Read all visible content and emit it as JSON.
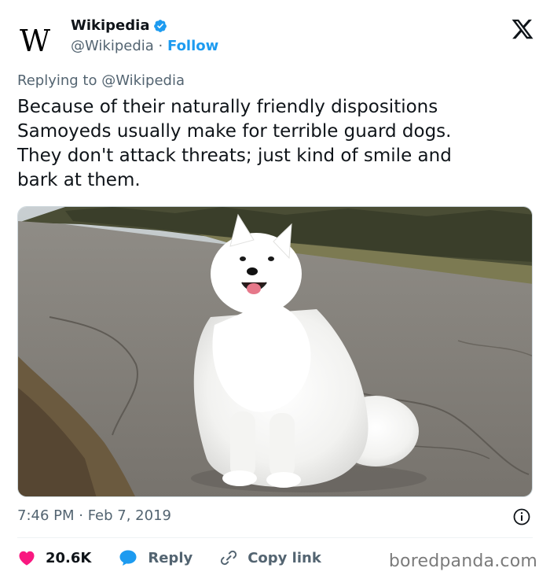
{
  "account": {
    "display_name": "Wikipedia",
    "handle": "@Wikipedia",
    "separator": "·",
    "follow_label": "Follow",
    "logo_letter": "W"
  },
  "tweet": {
    "replying_to": "Replying to @Wikipedia",
    "text": "Because of their naturally friendly dispositions\nSamoyeds usually make for terrible guard dogs.\nThey don't attack threats; just kind of smile and\nbark at them.",
    "timestamp": "7:46 PM · Feb 7, 2019"
  },
  "actions": {
    "likes": "20.6K",
    "reply_label": "Reply",
    "copy_link_label": "Copy link"
  },
  "watermark": "boredpanda.com",
  "icons": [
    "verified-badge-icon",
    "x-logo-icon",
    "info-icon",
    "heart-icon",
    "reply-bubble-icon",
    "link-icon"
  ],
  "colors": {
    "accent": "#1d9bf0",
    "like": "#f91880",
    "secondary_text": "#536471"
  }
}
